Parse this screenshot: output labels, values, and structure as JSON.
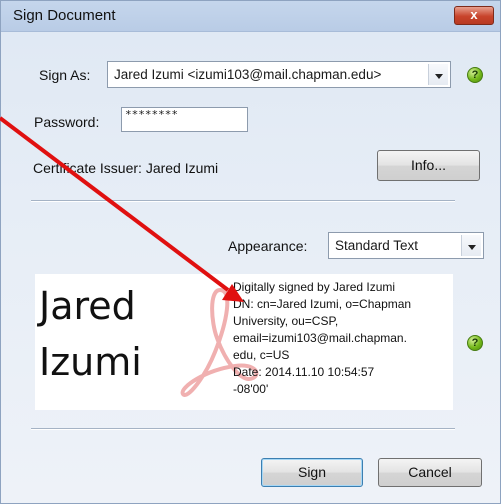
{
  "window": {
    "title": "Sign Document",
    "close_label": "x"
  },
  "sign_as": {
    "label": "Sign As:",
    "value": "Jared Izumi <izumi103@mail.chapman.edu>"
  },
  "password": {
    "label": "Password:",
    "value": "********"
  },
  "certificate": {
    "label": "Certificate Issuer: Jared Izumi"
  },
  "info_button": {
    "label": "Info..."
  },
  "appearance": {
    "label": "Appearance:",
    "value": "Standard Text"
  },
  "preview": {
    "name_line1": "Jared",
    "name_line2": "Izumi",
    "details": [
      "Digitally signed by Jared Izumi",
      "DN: cn=Jared Izumi, o=Chapman",
      "University, ou=CSP,",
      "email=izumi103@mail.chapman.",
      "edu, c=US",
      "Date: 2014.11.10 10:54:57",
      "-08'00'"
    ]
  },
  "help_icon": {
    "glyph": "?"
  },
  "buttons": {
    "sign": "Sign",
    "cancel": "Cancel"
  },
  "colors": {
    "annotation_arrow": "#e01010",
    "help_green": "#74b81a",
    "watermark": "#f0b0b0"
  }
}
